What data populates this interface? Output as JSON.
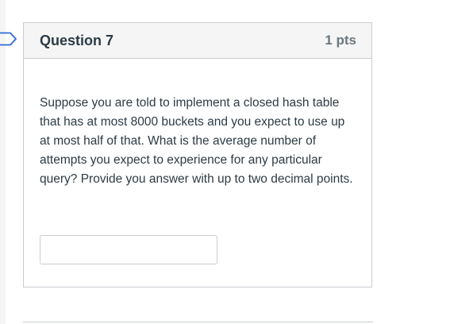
{
  "question": {
    "title": "Question 7",
    "points": "1 pts",
    "text": "Suppose you are told to implement a closed hash table that has at most 8000 buckets and you expect to use up at most half of that.  What is the average number of attempts you expect to experience for any particular query? Provide you answer with up to two decimal points.",
    "answer_value": "",
    "answer_placeholder": ""
  },
  "icons": {
    "flag": "flag-outline-icon"
  },
  "colors": {
    "text": "#2d3b45",
    "points": "#6b7780",
    "header_bg": "#f5f5f5",
    "border": "#c7cdd1",
    "flag": "#2d6bd6"
  }
}
